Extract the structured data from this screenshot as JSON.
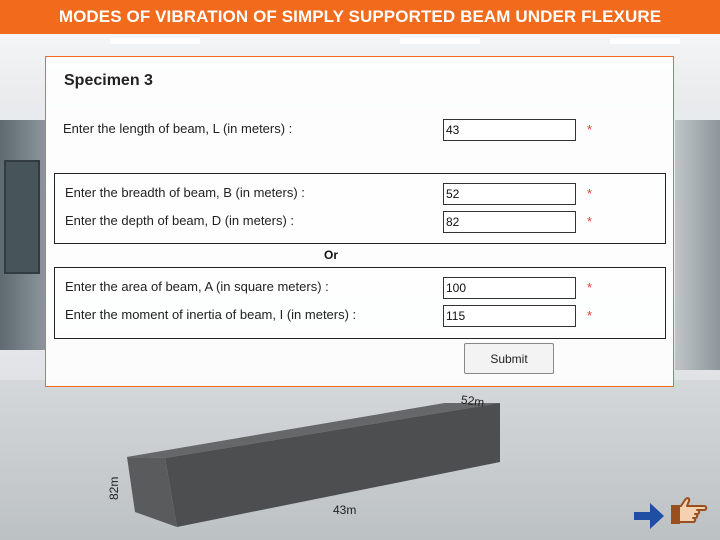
{
  "header": {
    "title": "MODES OF VIBRATION OF SIMPLY SUPPORTED BEAM UNDER FLEXURE"
  },
  "form": {
    "specimen_title": "Specimen 3",
    "length": {
      "label": "Enter the length of beam, L (in meters) :",
      "value": "43",
      "required_mark": "*"
    },
    "breadth": {
      "label": "Enter the breadth of beam, B (in meters) :",
      "value": "52",
      "required_mark": "*"
    },
    "depth": {
      "label": "Enter the depth of beam, D (in meters) :",
      "value": "82",
      "required_mark": "*"
    },
    "or_label": "Or",
    "area": {
      "label": "Enter the area of beam, A (in square meters) :",
      "value": "100",
      "required_mark": "*"
    },
    "inertia": {
      "label": "Enter the moment of inertia of beam, I (in meters) :",
      "value": "115",
      "required_mark": "*"
    },
    "submit_label": "Submit"
  },
  "beam": {
    "length_label": "43m",
    "breadth_label": "52m",
    "depth_label": "82m"
  },
  "colors": {
    "accent": "#f26a1b",
    "required": "#e53935",
    "arrow": "#1f4fa3",
    "hand": "#9a4f1e"
  },
  "icons": {
    "next": "arrow-right-icon",
    "pointer": "pointing-hand-icon"
  }
}
